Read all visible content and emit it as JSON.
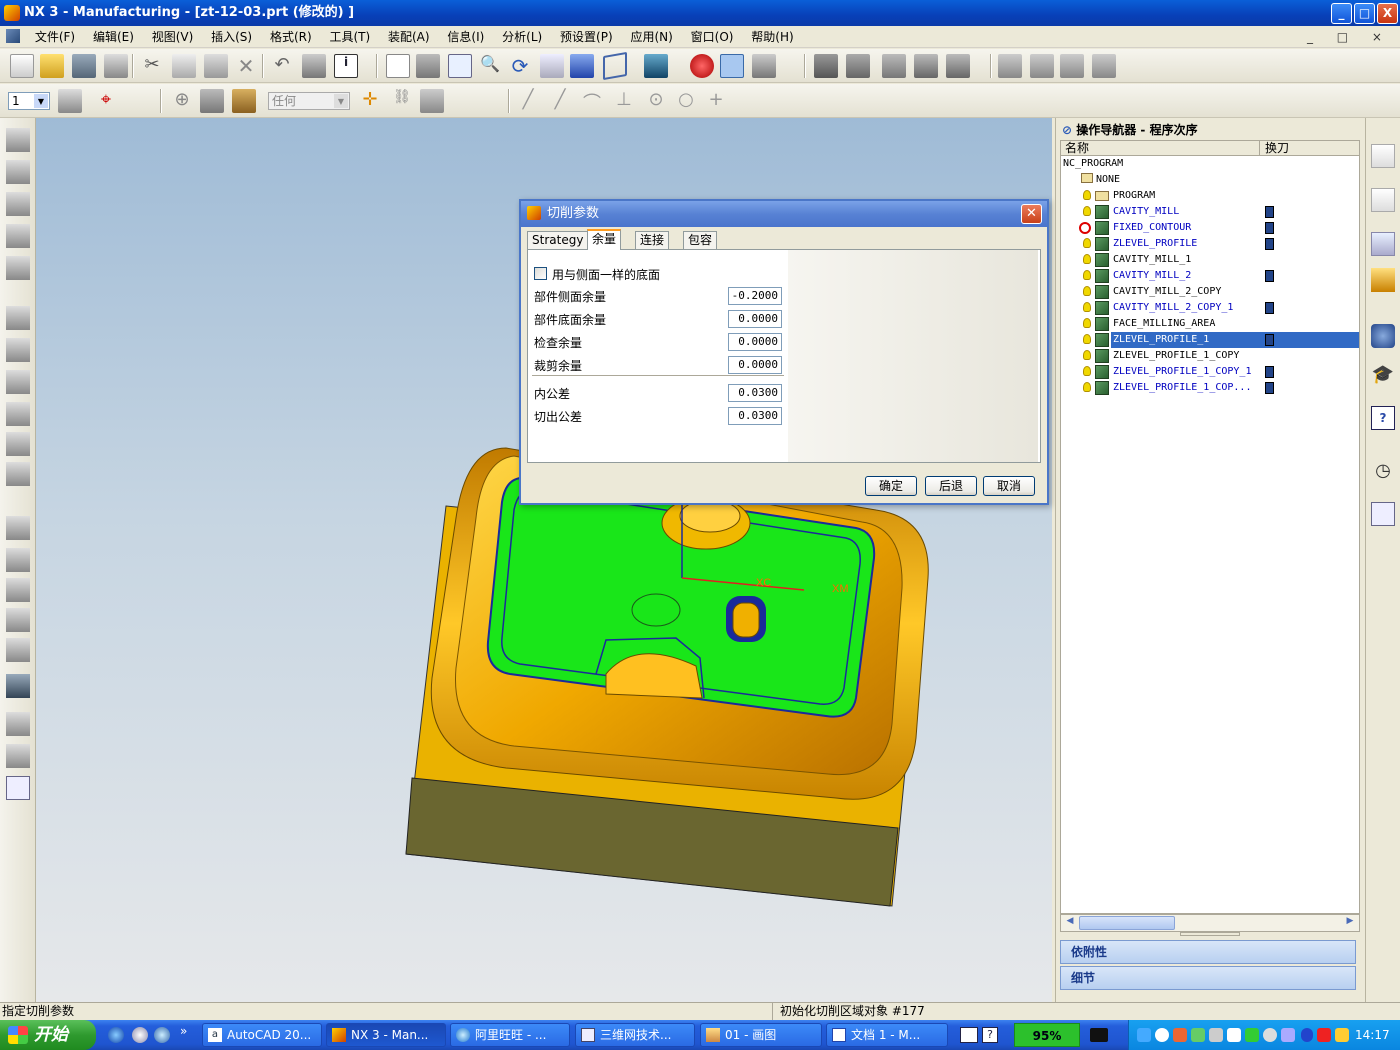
{
  "window": {
    "title": "NX 3 - Manufacturing - [zt-12-03.prt  (修改的) ]",
    "controls": [
      "_",
      "□",
      "X"
    ]
  },
  "menu": [
    "文件(F)",
    "编辑(E)",
    "视图(V)",
    "插入(S)",
    "格式(R)",
    "工具(T)",
    "装配(A)",
    "信息(I)",
    "分析(L)",
    "预设置(P)",
    "应用(N)",
    "窗口(O)",
    "帮助(H)"
  ],
  "mdi_controls": "_ □ ×",
  "toolbar2": {
    "layer_value": "1",
    "filter_value": "任何"
  },
  "dialog": {
    "title": "切削参数",
    "tabs": [
      "Strategy",
      "余量",
      "连接",
      "包容"
    ],
    "selected_tab": "余量",
    "checkbox_label": "用与侧面一样的底面",
    "fields": [
      {
        "label": "部件侧面余量",
        "value": "-0.2000"
      },
      {
        "label": "部件底面余量",
        "value": "0.0000"
      },
      {
        "label": "检查余量",
        "value": "0.0000"
      },
      {
        "label": "裁剪余量",
        "value": "0.0000"
      }
    ],
    "tolerances": [
      {
        "label": "内公差",
        "value": "0.0300"
      },
      {
        "label": "切出公差",
        "value": "0.0300"
      }
    ],
    "buttons": {
      "ok": "确定",
      "back": "后退",
      "cancel": "取消"
    }
  },
  "navigator": {
    "title": "操作导航器 - 程序次序",
    "columns": [
      "名称",
      "换刀"
    ],
    "root": "NC_PROGRAM",
    "group_none": "NONE",
    "items": [
      {
        "name": "PROGRAM",
        "type": "group",
        "color": "#000000",
        "tool": false
      },
      {
        "name": "CAVITY_MILL",
        "color": "#0000c0",
        "tool": true
      },
      {
        "name": "FIXED_CONTOUR",
        "color": "#0000c0",
        "tool": true,
        "error": true
      },
      {
        "name": "ZLEVEL_PROFILE",
        "color": "#0000c0",
        "tool": true
      },
      {
        "name": "CAVITY_MILL_1",
        "color": "#000000",
        "tool": false
      },
      {
        "name": "CAVITY_MILL_2",
        "color": "#0000c0",
        "tool": true
      },
      {
        "name": "CAVITY_MILL_2_COPY",
        "color": "#000000",
        "tool": false
      },
      {
        "name": "CAVITY_MILL_2_COPY_1",
        "color": "#0000c0",
        "tool": true
      },
      {
        "name": "FACE_MILLING_AREA",
        "color": "#000000",
        "tool": false
      },
      {
        "name": "ZLEVEL_PROFILE_1",
        "color": "#ffffff",
        "tool": true,
        "selected": true
      },
      {
        "name": "ZLEVEL_PROFILE_1_COPY",
        "color": "#000000",
        "tool": false
      },
      {
        "name": "ZLEVEL_PROFILE_1_COPY_1",
        "color": "#0000c0",
        "tool": true
      },
      {
        "name": "ZLEVEL_PROFILE_1_COP...",
        "color": "#0000c0",
        "tool": true
      }
    ],
    "panels": [
      "依附性",
      "细节"
    ]
  },
  "viewport": {
    "axis_labels": [
      "XC",
      "XM"
    ]
  },
  "status": {
    "left": "指定切削参数",
    "right": "初始化切削区域对象 #177"
  },
  "taskbar": {
    "start": "开始",
    "tasks": [
      "AutoCAD 20...",
      "NX 3 - Man...",
      "阿里旺旺 - ...",
      "三维网技术...",
      "01 - 画图",
      "文档 1 - M..."
    ],
    "active_task": "NX 3 - Man...",
    "battery": "95%",
    "clock": "14:17"
  }
}
